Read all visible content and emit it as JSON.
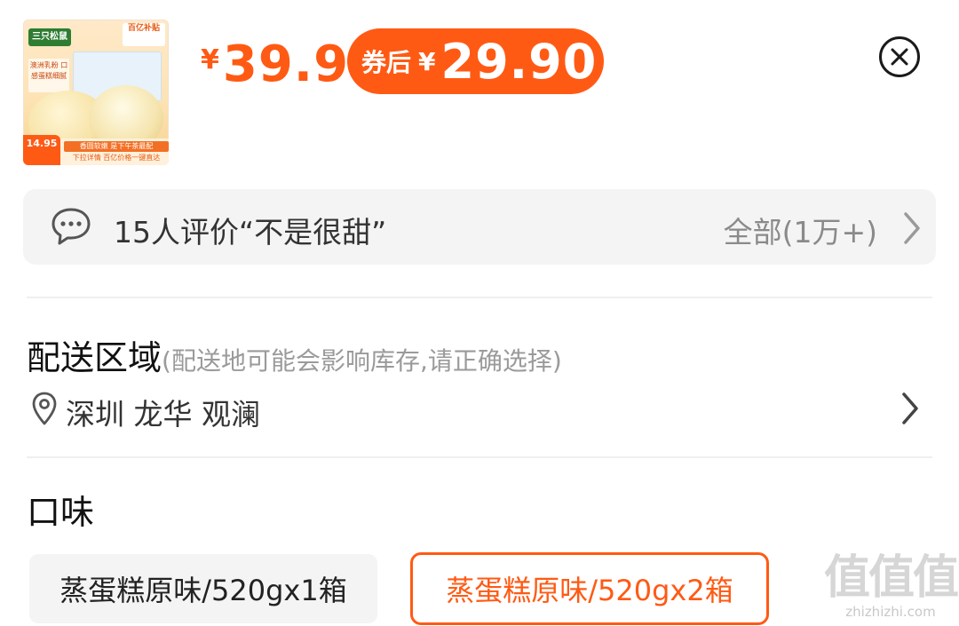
{
  "product": {
    "thumb": {
      "brand": "三只松鼠",
      "tag": "百亿补贴",
      "side_text": "澳洲乳粉 口感蛋糕细腻",
      "banner_1": "香圆软嫩 是下午茶最配",
      "banner_2": "下拉详情 百亿价格一键直达",
      "price_badge": "14.95"
    },
    "price": {
      "currency": "¥",
      "original": "39.9",
      "coupon_label": "券后",
      "coupon_price": "29.90"
    }
  },
  "review": {
    "text": "15人评价“不是很甜”",
    "all_label": "全部(1万+)"
  },
  "delivery": {
    "title": "配送区域",
    "hint": "(配送地可能会影响库存,请正确选择)",
    "address": "深圳 龙华 观澜"
  },
  "flavor": {
    "title": "口味",
    "options": [
      {
        "label": "蒸蛋糕原味/520gx1箱",
        "selected": false
      },
      {
        "label": "蒸蛋糕原味/520gx2箱",
        "selected": true
      }
    ]
  },
  "watermark": {
    "glyphs": "值值值",
    "domain": "zhizhizhi.com"
  },
  "colors": {
    "accent": "#ff5a14",
    "muted": "#9a9a9a",
    "panel": "#f4f4f4"
  }
}
